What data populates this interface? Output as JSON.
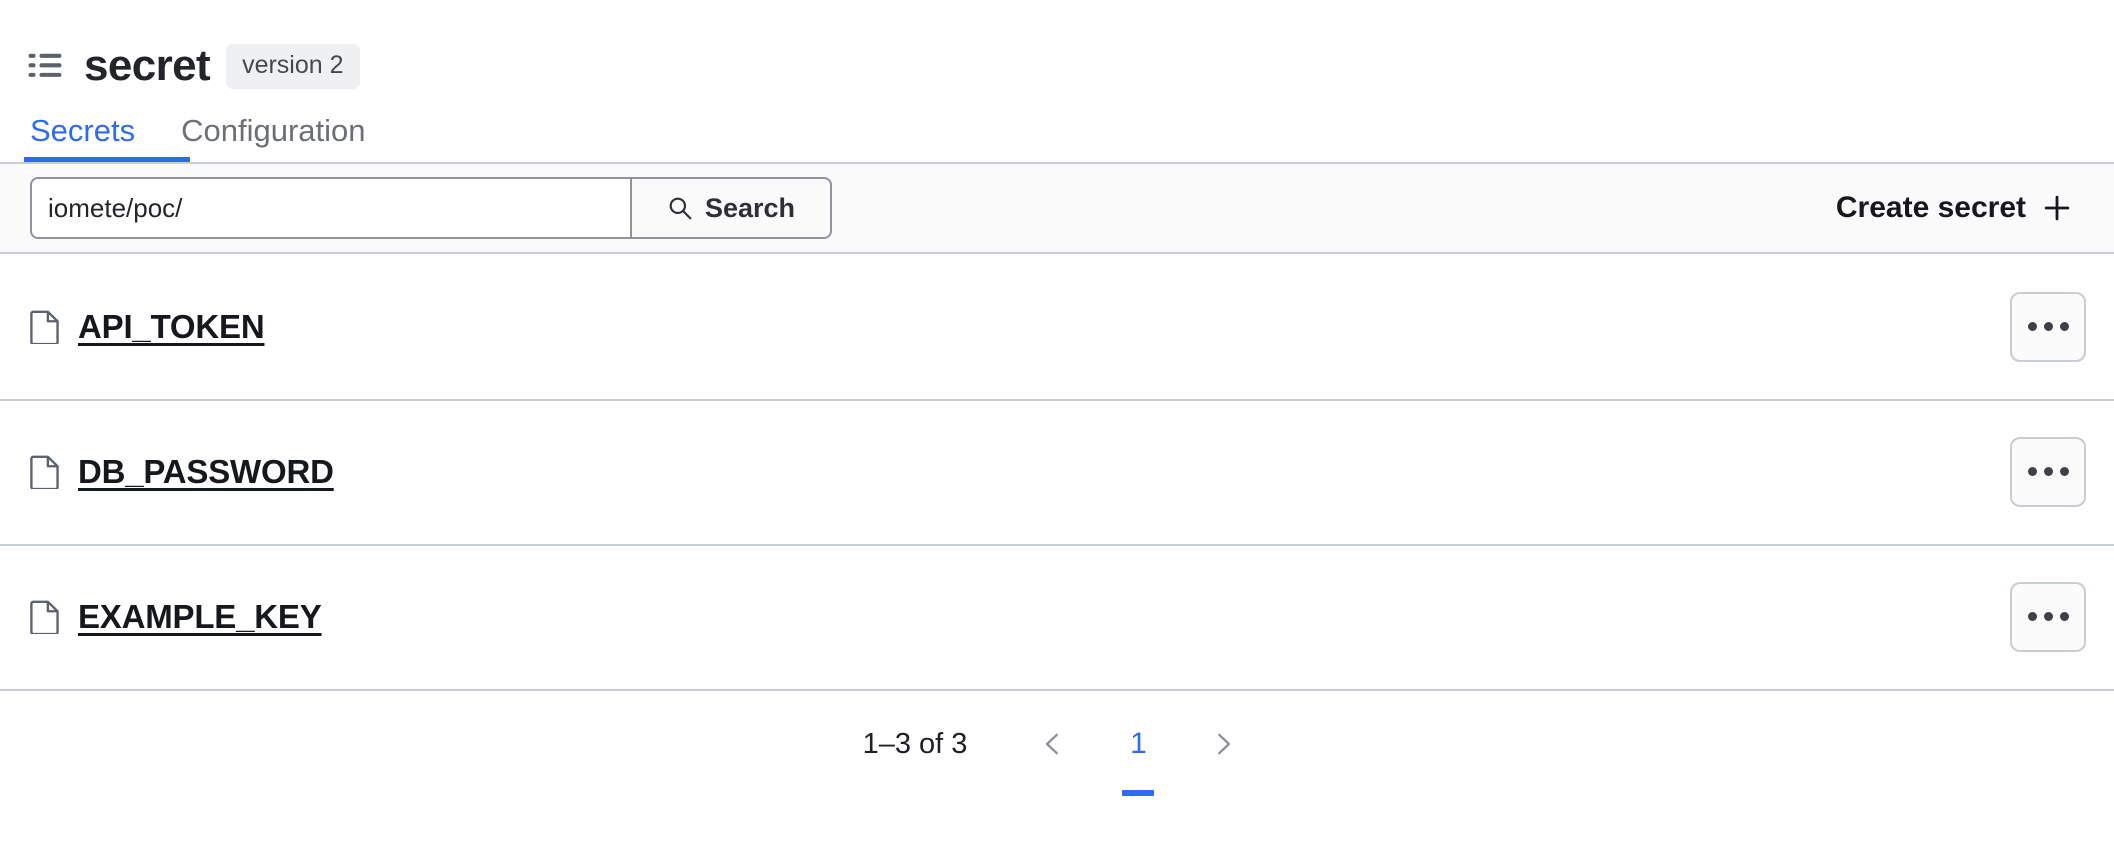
{
  "header": {
    "icon": "list-icon",
    "title": "secret",
    "version_badge": "version 2"
  },
  "tabs": [
    {
      "label": "Secrets",
      "active": true
    },
    {
      "label": "Configuration",
      "active": false
    }
  ],
  "toolbar": {
    "search_value": "iomete/poc/",
    "search_placeholder": "",
    "search_button_label": "Search",
    "search_icon": "search-icon",
    "create_secret_label": "Create secret",
    "create_secret_icon": "plus-icon"
  },
  "secrets": [
    {
      "name": "API_TOKEN",
      "icon": "file-icon",
      "menu": "kebab-menu"
    },
    {
      "name": "DB_PASSWORD",
      "icon": "file-icon",
      "menu": "kebab-menu"
    },
    {
      "name": "EXAMPLE_KEY",
      "icon": "file-icon",
      "menu": "kebab-menu"
    }
  ],
  "pagination": {
    "range_label": "1–3 of 3",
    "prev_icon": "chevron-left-icon",
    "next_icon": "chevron-right-icon",
    "current_page": "1"
  },
  "colors": {
    "accent": "#2f6bf2",
    "text": "#15181c",
    "muted": "#6b7076",
    "border": "#c8ccd4",
    "toolbar_bg": "#fafafb",
    "badge_bg": "#eff0f2"
  }
}
